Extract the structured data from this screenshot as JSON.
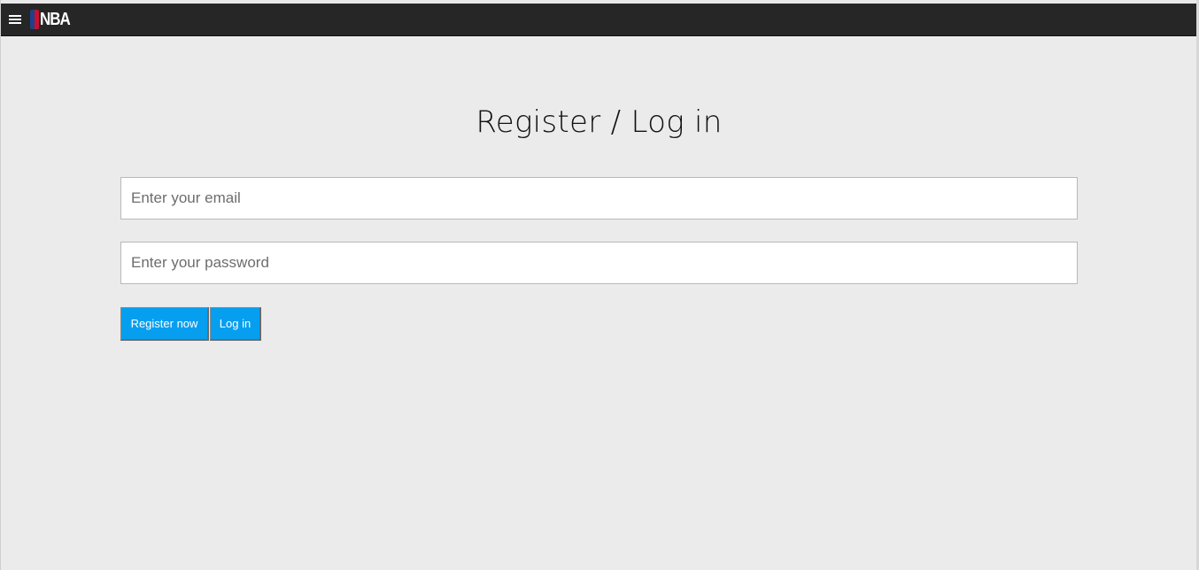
{
  "header": {
    "logo_text": "NBA",
    "logo_colors": {
      "left": "#1d428a",
      "right": "#c8102e"
    },
    "menu_icon": "hamburger-menu-icon",
    "background": "#262626"
  },
  "main": {
    "title": "Register / Log in",
    "email": {
      "placeholder": "Enter your email",
      "value": ""
    },
    "password": {
      "placeholder": "Enter your password",
      "value": ""
    },
    "buttons": {
      "register_label": "Register now",
      "login_label": "Log in",
      "color": "#069ff0"
    },
    "background": "#ebebeb"
  }
}
